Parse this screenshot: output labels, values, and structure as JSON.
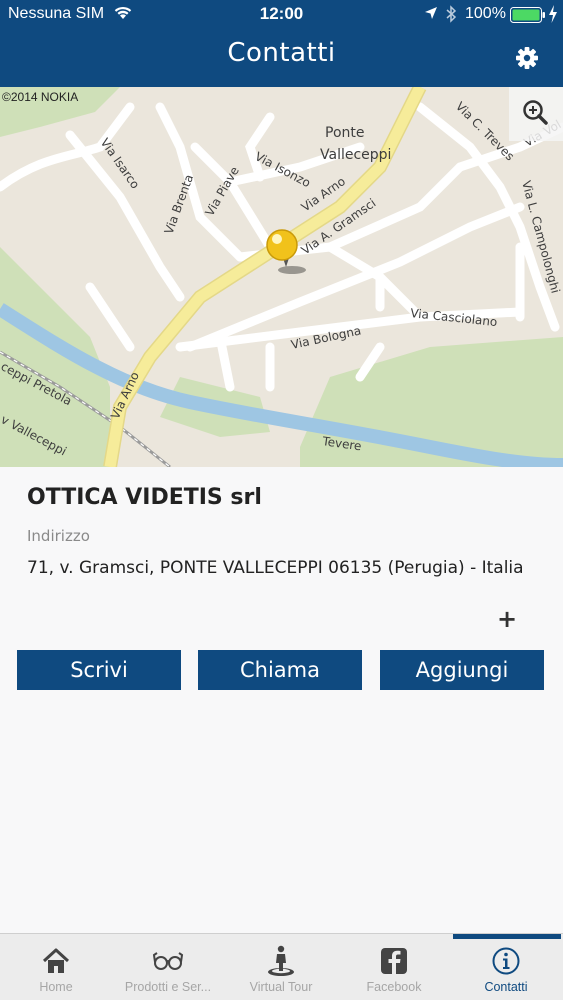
{
  "status_bar": {
    "carrier": "Nessuna SIM",
    "time": "12:00",
    "battery": "100%"
  },
  "header": {
    "title": "Contatti",
    "settings_icon": "gear-icon"
  },
  "map": {
    "copyright": "©2014 NOKIA",
    "zoom_icon": "zoom-in-icon",
    "labels": {
      "ponte": "Ponte",
      "valleceppi": "Valleceppi",
      "via_isarco": "Via Isarco",
      "via_brenta": "Via Brenta",
      "via_piave": "Via Piave",
      "via_isonzo": "Via Isonzo",
      "via_arno_top": "Via Arno",
      "via_a_gramsci": "Via A. Gramsci",
      "via_c_treves": "Via C. Treves",
      "via_vol": "Via Vol",
      "via_l_campolonghi": "Via L. Campolonghi",
      "via_casciolano": "Via Casciolano",
      "via_bologna": "Via Bologna",
      "via_arno_bottom": "Via Arno",
      "via_pretola": "ceppi Pretola",
      "via_vallecceppi": "v Valleceppi",
      "tevere": "Tevere"
    }
  },
  "contact": {
    "name": "OTTICA VIDETIS srl",
    "address_label": "Indirizzo",
    "address": "71, v. Gramsci, PONTE VALLECEPPI 06135 (Perugia) - Italia",
    "expand_symbol": "+"
  },
  "actions": {
    "write": "Scrivi",
    "call": "Chiama",
    "add": "Aggiungi"
  },
  "tabs": [
    {
      "label": "Home",
      "icon": "home-icon"
    },
    {
      "label": "Prodotti e Ser...",
      "icon": "glasses-icon"
    },
    {
      "label": "Virtual Tour",
      "icon": "person-pin-icon"
    },
    {
      "label": "Facebook",
      "icon": "facebook-icon"
    },
    {
      "label": "Contatti",
      "icon": "info-icon",
      "active": true
    }
  ],
  "colors": {
    "brand": "#0f4a80",
    "road_main": "#f6ec9a",
    "river": "#9ec6e3"
  }
}
